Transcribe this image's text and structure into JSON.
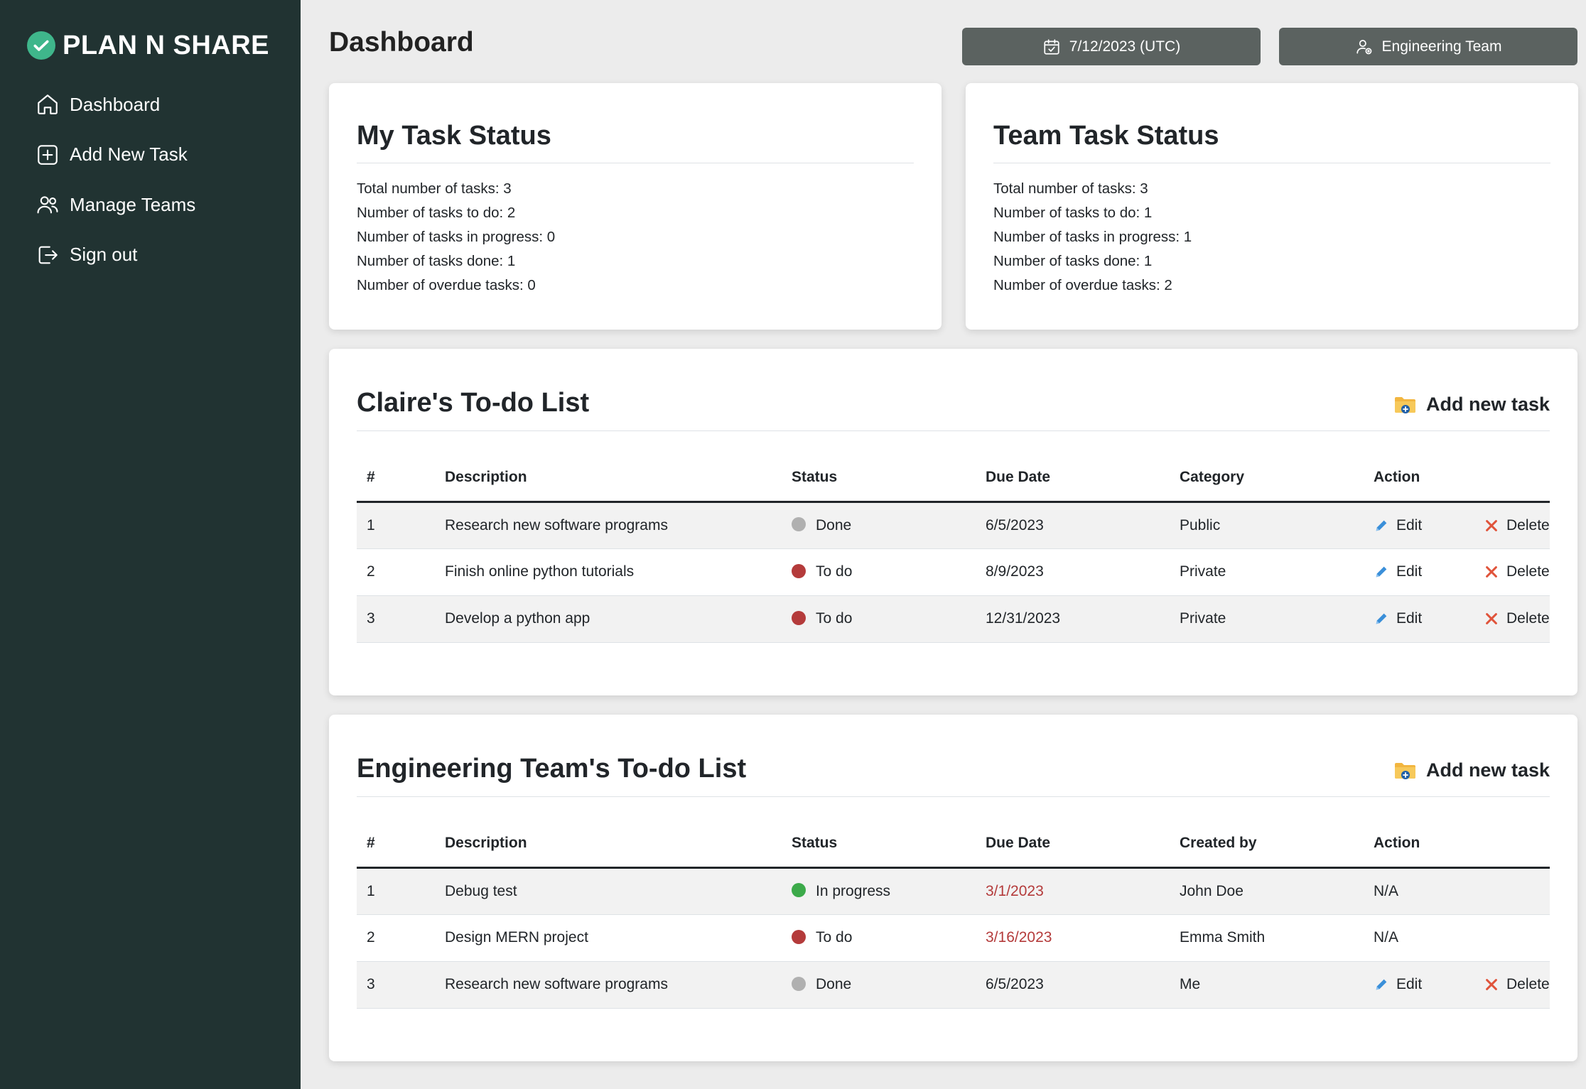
{
  "app": {
    "brand": "PLAN N SHARE"
  },
  "sidebar": {
    "items": [
      {
        "label": "Dashboard",
        "icon": "home-icon"
      },
      {
        "label": "Add New Task",
        "icon": "plus-square-icon"
      },
      {
        "label": "Manage Teams",
        "icon": "users-icon"
      },
      {
        "label": "Sign out",
        "icon": "sign-out-icon"
      }
    ]
  },
  "header": {
    "title": "Dashboard",
    "date_button": "7/12/2023 (UTC)",
    "team_button": "Engineering Team"
  },
  "my_status": {
    "title": "My Task Status",
    "lines": [
      "Total number of tasks: 3",
      "Number of tasks to do: 2",
      "Number of tasks in progress: 0",
      "Number of tasks done: 1",
      "Number of overdue tasks: 0"
    ]
  },
  "team_status": {
    "title": "Team Task Status",
    "lines": [
      "Total number of tasks: 3",
      "Number of tasks to do: 1",
      "Number of tasks in progress: 1",
      "Number of tasks done: 1",
      "Number of overdue tasks: 2"
    ]
  },
  "personal_list": {
    "title": "Claire's To-do List",
    "add_label": "Add new task",
    "columns": [
      "#",
      "Description",
      "Status",
      "Due Date",
      "Category",
      "Action"
    ],
    "rows": [
      {
        "num": "1",
        "desc": "Research new software programs",
        "status": "Done",
        "due": "6/5/2023",
        "cat": "Public",
        "edit": "Edit",
        "delete": "Delete"
      },
      {
        "num": "2",
        "desc": "Finish online python tutorials",
        "status": "To do",
        "due": "8/9/2023",
        "cat": "Private",
        "edit": "Edit",
        "delete": "Delete"
      },
      {
        "num": "3",
        "desc": "Develop a python app",
        "status": "To do",
        "due": "12/31/2023",
        "cat": "Private",
        "edit": "Edit",
        "delete": "Delete"
      }
    ]
  },
  "team_list": {
    "title": "Engineering Team's To-do List",
    "add_label": "Add new task",
    "columns": [
      "#",
      "Description",
      "Status",
      "Due Date",
      "Created by",
      "Action"
    ],
    "rows": [
      {
        "num": "1",
        "desc": "Debug test",
        "status": "In progress",
        "due": "3/1/2023",
        "by": "John Doe",
        "action": "N/A"
      },
      {
        "num": "2",
        "desc": "Design MERN project",
        "status": "To do",
        "due": "3/16/2023",
        "by": "Emma Smith",
        "action": "N/A"
      },
      {
        "num": "3",
        "desc": "Research new software programs",
        "status": "Done",
        "due": "6/5/2023",
        "by": "Me",
        "edit": "Edit",
        "delete": "Delete"
      }
    ]
  },
  "colors": {
    "sidebar_bg": "#213332",
    "brand_check": "#3fb68b",
    "status_done": "#b0b0b0",
    "status_todo": "#b43b3b",
    "status_inprogress": "#3caa4a",
    "overdue_text": "#b43b3b",
    "edit_icon": "#3a8fd9",
    "delete_icon": "#e0533a"
  }
}
